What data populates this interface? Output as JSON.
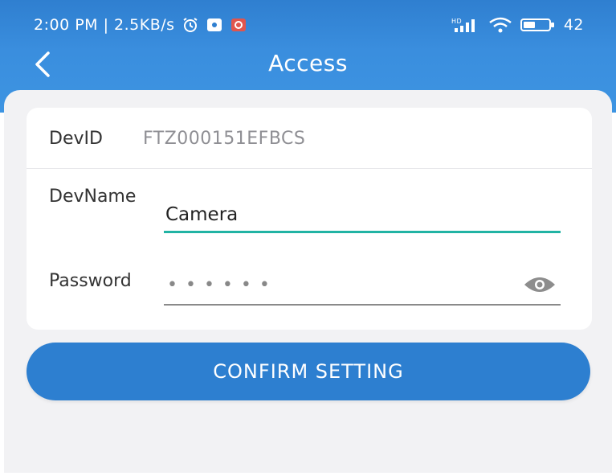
{
  "status_bar": {
    "time_and_speed": "2:00 PM | 2.5KB/s",
    "battery_text": "42",
    "icons": [
      "alarm-icon",
      "app-notification-icon",
      "app-notification-icon-2",
      "signal-hd-icon",
      "wifi-icon",
      "battery-icon"
    ]
  },
  "header": {
    "title": "Access",
    "back_icon": "chevron-left-icon"
  },
  "form": {
    "devid_label": "DevID",
    "devid_value": "FTZ000151EFBCS",
    "devname_label": "DevName",
    "devname_value": "Camera",
    "password_label": "Password",
    "password_value": "••••••",
    "password_toggle_icon": "eye-icon"
  },
  "actions": {
    "confirm_label": "CONFIRM SETTING"
  },
  "colors": {
    "header_blue": "#3a8ede",
    "button_blue": "#2d7fd0",
    "active_underline": "#21b3a4",
    "background": "#f2f2f4"
  }
}
